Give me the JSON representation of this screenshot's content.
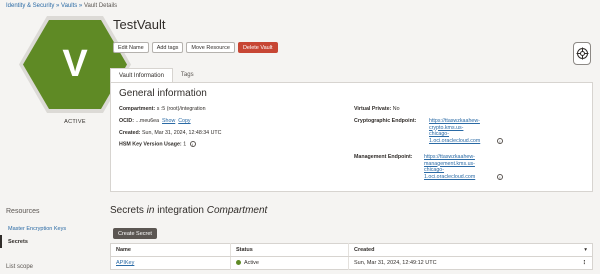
{
  "breadcrumb": {
    "item1": "Identity & Security",
    "sep1": " » ",
    "item2": "Vaults",
    "sep2": " » ",
    "current": "Vault Details"
  },
  "vault": {
    "icon_letter": "V",
    "status": "ACTIVE",
    "name": "TestVault"
  },
  "colors": {
    "active_green": "#5f8a25",
    "danger": "#c74634",
    "link": "#2a6aa5"
  },
  "actions": {
    "edit_name": "Edit Name",
    "add_tags": "Add tags",
    "move_resource": "Move Resource",
    "delete_vault": "Delete Vault"
  },
  "tabs": {
    "vault_info": "Vault Information",
    "tags": "Tags"
  },
  "general": {
    "heading": "General information",
    "compartment_label": "Compartment:",
    "compartment_value": "s              :5 (root)/integration",
    "ocid_label": "OCID:",
    "ocid_value": "...meu6ea",
    "show": "Show",
    "copy": "Copy",
    "created_label": "Created:",
    "created_value": "Sun, Mar 31, 2024, 12:48:34 UTC",
    "hsm_label": "HSM Key Version Usage:",
    "hsm_value": "1",
    "virtual_private_label": "Virtual Private:",
    "virtual_private_value": "No",
    "crypto_label": "Cryptographic Endpoint:",
    "crypto_lines": [
      "https://ttaswzkaahew-",
      "crypto.kms.us-",
      "chicago-",
      "1.oci.oraclecloud.com"
    ],
    "mgmt_label": "Management Endpoint:",
    "mgmt_lines": [
      "https://ttaswzkaahew-",
      "management.kms.us-",
      "chicago-",
      "1.oci.oraclecloud.com"
    ],
    "info_glyph": "i"
  },
  "sidebar": {
    "heading": "Resources",
    "items": [
      "Master Encryption Keys",
      "Secrets"
    ],
    "list_scope": "List scope"
  },
  "secrets": {
    "title_a": "Secrets",
    "title_b": " in ",
    "title_c": "integration",
    "title_d": " Compartment",
    "create_button": "Create Secret",
    "columns": [
      "Name",
      "Status",
      "Created"
    ],
    "rows": [
      {
        "name": "APIKey",
        "status": "Active",
        "created": "Sun, Mar 31, 2024, 12:49:12 UTC"
      }
    ],
    "sort_glyph": "▾",
    "row_menu_glyph": "⋮"
  }
}
